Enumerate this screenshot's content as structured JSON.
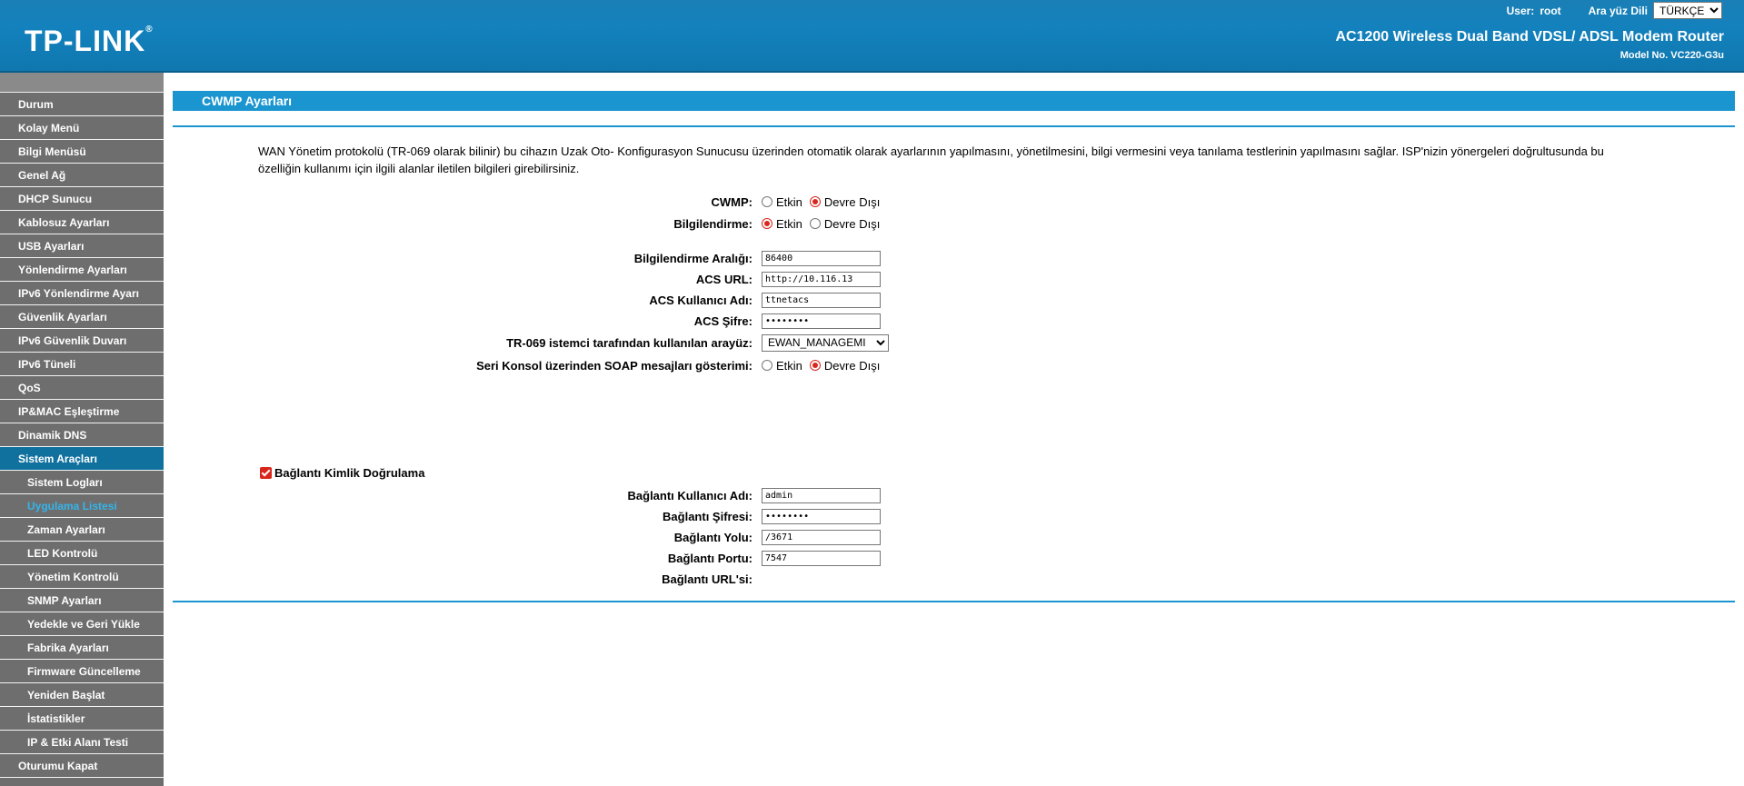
{
  "header": {
    "logo": "TP-LINK",
    "logo_mark": "®",
    "user_label": "User:",
    "user_name": "root",
    "lang_label": "Ara yüz Dili",
    "lang_value": "TÜRKÇE",
    "router_title": "AC1200 Wireless Dual Band VDSL/ ADSL Modem Router",
    "model_no": "Model No. VC220-G3u"
  },
  "sidebar": {
    "items": [
      {
        "label": "Durum"
      },
      {
        "label": "Kolay Menü"
      },
      {
        "label": "Bilgi Menüsü"
      },
      {
        "label": "Genel Ağ"
      },
      {
        "label": "DHCP Sunucu"
      },
      {
        "label": "Kablosuz Ayarları"
      },
      {
        "label": "USB Ayarları"
      },
      {
        "label": "Yönlendirme Ayarları"
      },
      {
        "label": "IPv6 Yönlendirme Ayarı"
      },
      {
        "label": "Güvenlik Ayarları"
      },
      {
        "label": "IPv6 Güvenlik Duvarı"
      },
      {
        "label": "IPv6 Tüneli"
      },
      {
        "label": "QoS"
      },
      {
        "label": "IP&MAC Eşleştirme"
      },
      {
        "label": "Dinamik DNS"
      },
      {
        "label": "Sistem Araçları"
      },
      {
        "label": "Sistem Logları"
      },
      {
        "label": "Uygulama Listesi"
      },
      {
        "label": "Zaman Ayarları"
      },
      {
        "label": "LED Kontrolü"
      },
      {
        "label": "Yönetim Kontrolü"
      },
      {
        "label": "SNMP Ayarları"
      },
      {
        "label": "Yedekle ve Geri Yükle"
      },
      {
        "label": "Fabrika Ayarları"
      },
      {
        "label": "Firmware Güncelleme"
      },
      {
        "label": "Yeniden Başlat"
      },
      {
        "label": "İstatistikler"
      },
      {
        "label": "IP & Etki Alanı Testi"
      },
      {
        "label": "Oturumu Kapat"
      }
    ]
  },
  "main": {
    "title": "CWMP Ayarları",
    "description": "WAN Yönetim protokolü (TR-069 olarak bilinir) bu cihazın Uzak Oto- Konfigurasyon Sunucusu üzerinden otomatik olarak ayarlarının yapılmasını, yönetilmesini, bilgi vermesini veya tanılama testlerinin yapılmasını sağlar. ISP'nizin yönergeleri doğrultusunda bu özelliğin kullanımı için ilgili alanlar iletilen bilgileri girebilirsiniz.",
    "option_enable": "Etkin",
    "option_disable": "Devre Dışı",
    "cwmp_label": "CWMP:",
    "cwmp_selected": "Devre Dışı",
    "inform_label": "Bilgilendirme:",
    "inform_selected": "Etkin",
    "inform_interval_label": "Bilgilendirme Aralığı:",
    "inform_interval_value": "86400",
    "acs_url_label": "ACS URL:",
    "acs_url_value": "http://10.116.13",
    "acs_user_label": "ACS Kullanıcı Adı:",
    "acs_user_value": "ttnetacs",
    "acs_pass_label": "ACS Şifre:",
    "acs_pass_value": "••••••••",
    "interface_label": "TR-069 istemci tarafından kullanılan arayüz:",
    "interface_value": "EWAN_MANAGEMI",
    "soap_label": "Seri Konsol üzerinden SOAP mesajları gösterimi:",
    "soap_selected": "Devre Dışı",
    "conn_auth_label": "Bağlantı Kimlik Doğrulama",
    "conn_auth_checked": true,
    "conn_user_label": "Bağlantı Kullanıcı Adı:",
    "conn_user_value": "admin",
    "conn_pass_label": "Bağlantı Şifresi:",
    "conn_pass_value": "••••••••",
    "conn_path_label": "Bağlantı Yolu:",
    "conn_path_value": "/3671",
    "conn_port_label": "Bağlantı Portu:",
    "conn_port_value": "7547",
    "conn_url_label": "Bağlantı URL'si:",
    "conn_url_value": ""
  },
  "colors": {
    "header_blue": "#1381bd",
    "accent_blue": "#1a95d0",
    "sidebar_gray": "#6e6e6e",
    "active_nav": "#10719f",
    "current_link": "#33b5ec",
    "radio_red": "#d9261c"
  }
}
